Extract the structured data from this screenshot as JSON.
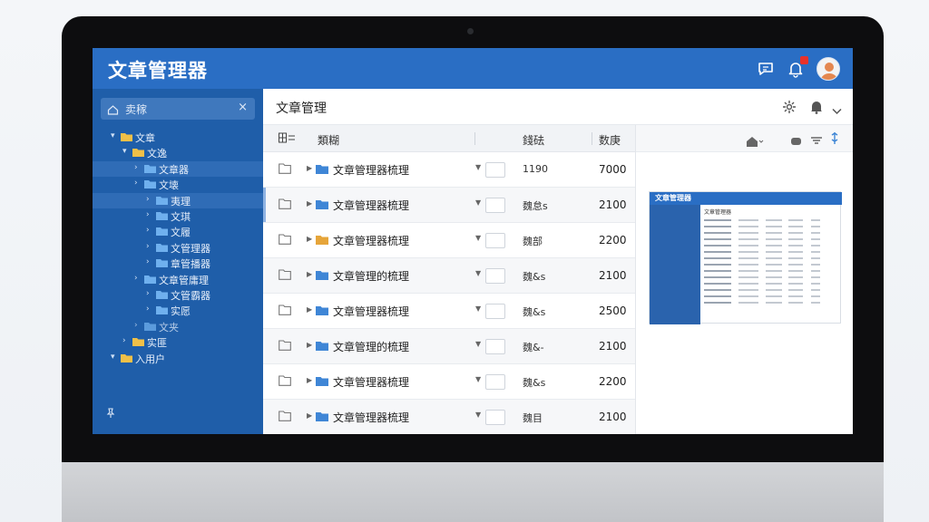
{
  "app": {
    "title": "文章管理器"
  },
  "sidebar": {
    "search": {
      "value": "卖稼"
    },
    "tree": [
      {
        "label": "文章",
        "depth": 0,
        "expanded": true
      },
      {
        "label": "文逸",
        "depth": 1,
        "expanded": true
      },
      {
        "label": "文章器",
        "depth": 2,
        "expanded": false,
        "selected": true
      },
      {
        "label": "文壊",
        "depth": 2,
        "expanded": false
      },
      {
        "label": "夷理",
        "depth": 3,
        "expanded": false,
        "selected": true
      },
      {
        "label": "文琪",
        "depth": 3,
        "expanded": false
      },
      {
        "label": "文履",
        "depth": 3,
        "expanded": false
      },
      {
        "label": "文管理器",
        "depth": 3,
        "expanded": false
      },
      {
        "label": "章管播器",
        "depth": 3,
        "expanded": false
      },
      {
        "label": "文章管庸理",
        "depth": 2,
        "expanded": false
      },
      {
        "label": "文管霸器",
        "depth": 3,
        "expanded": false
      },
      {
        "label": "实愿",
        "depth": 3,
        "expanded": false
      },
      {
        "label": "文夹",
        "depth": 2,
        "expanded": false,
        "dim": true
      },
      {
        "label": "实匪",
        "depth": 1,
        "expanded": false
      },
      {
        "label": "入用户",
        "depth": 0,
        "expanded": true
      }
    ]
  },
  "main": {
    "title": "文章管理",
    "columns": {
      "name": "類糊",
      "status": "錢砝",
      "count": "数庚"
    },
    "rows": [
      {
        "name": "文章管理器梳理",
        "status": "1190",
        "count": "7000",
        "folder_color": "#3f86d6"
      },
      {
        "name": "文章管理器梳理",
        "status": "魏怠s",
        "count": "2100",
        "folder_color": "#3f86d6"
      },
      {
        "name": "文章管理器梳理",
        "status": "魏部",
        "count": "2200",
        "folder_color": "#e6a53a"
      },
      {
        "name": "文章管理的梳理",
        "status": "魏&s",
        "count": "2100",
        "folder_color": "#3f86d6"
      },
      {
        "name": "文章管理器梳理",
        "status": "魏&s",
        "count": "2500",
        "folder_color": "#3f86d6"
      },
      {
        "name": "文章管理的梳理",
        "status": "魏&-",
        "count": "2100",
        "folder_color": "#3f86d6"
      },
      {
        "name": "文章管理器梳理",
        "status": "魏&s",
        "count": "2200",
        "folder_color": "#3f86d6"
      },
      {
        "name": "文章管理器梳理",
        "status": "魏目",
        "count": "2100",
        "folder_color": "#3f86d6"
      }
    ]
  },
  "preview": {
    "thumb_title": "文章管理器",
    "thumb_sub": "文章管理器"
  },
  "colors": {
    "header": "#2a6ec4",
    "sidebar": "#1f5ea9",
    "folder": "#3f86d6",
    "badge": "#e8322a"
  },
  "icons": {
    "header": [
      "chat-icon",
      "bell-icon",
      "avatar"
    ],
    "main_toolbar": [
      "settings-icon",
      "bell-icon",
      "chevron-down-icon"
    ],
    "preview_toolbar": [
      "home-icon",
      "eye-icon",
      "wifi-icon",
      "flag-icon"
    ]
  }
}
